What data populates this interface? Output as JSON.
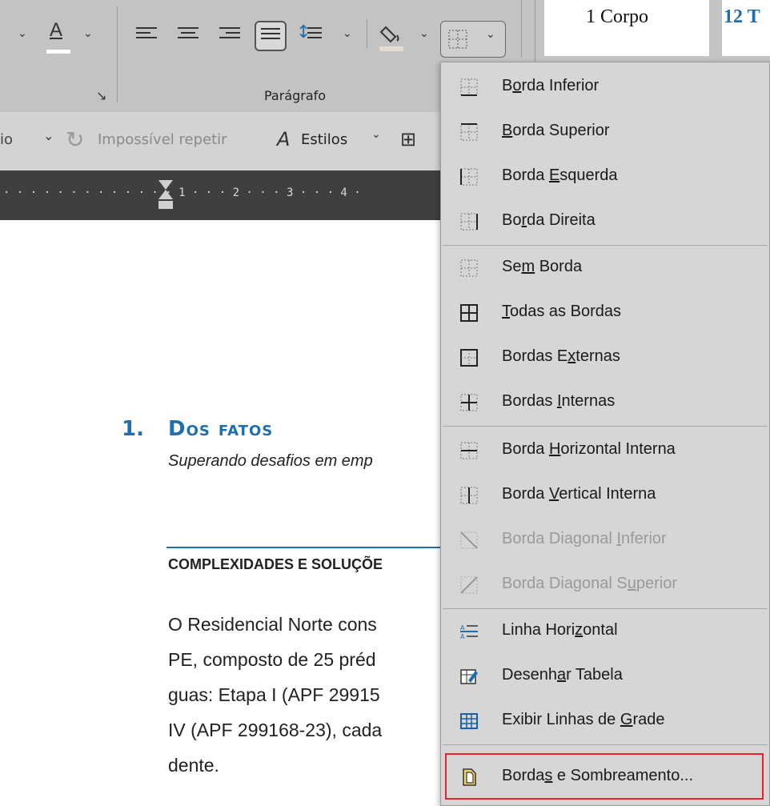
{
  "ribbon": {
    "font_color_label": "A",
    "style_normal": "1 Corpo",
    "style_title": "12 T",
    "dialog_launcher": "↘",
    "group_paragraph": "Parágrafo",
    "undo_partial": "io",
    "redo_label": "Impossível repetir",
    "styles_label": "Estilos"
  },
  "ruler": {
    "marks": "· · · · · · · · · · · · · 1 · · · 2 · · · 3 · · · 4 ·"
  },
  "document": {
    "heading_number": "1.",
    "heading_text": "Dos fatos",
    "subtitle": "Superando desafios em emp",
    "section_heading": "COMPLEXIDADES E SOLUÇÕE",
    "body_lines": [
      "O Residencial Norte cons",
      "PE, composto de 25 préd",
      "guas: Etapa I (APF 29915",
      "IV (APF 299168-23), cada",
      "dente."
    ]
  },
  "menu": {
    "items": [
      {
        "icon": "border-bottom-icon",
        "pre": "B",
        "u": "o",
        "post": "rda Inferior",
        "disabled": false
      },
      {
        "icon": "border-top-icon",
        "pre": "",
        "u": "B",
        "post": "orda Superior",
        "disabled": false
      },
      {
        "icon": "border-left-icon",
        "pre": "Borda ",
        "u": "E",
        "post": "squerda",
        "disabled": false
      },
      {
        "icon": "border-right-icon",
        "pre": "Bo",
        "u": "r",
        "post": "da Direita",
        "disabled": false
      },
      {
        "icon": "no-border-icon",
        "pre": "Se",
        "u": "m",
        "post": " Borda",
        "disabled": false
      },
      {
        "icon": "all-borders-icon",
        "pre": "",
        "u": "T",
        "post": "odas as Bordas",
        "disabled": false
      },
      {
        "icon": "outside-borders-icon",
        "pre": "Bordas E",
        "u": "x",
        "post": "ternas",
        "disabled": false
      },
      {
        "icon": "inside-borders-icon",
        "pre": "Bordas ",
        "u": "I",
        "post": "nternas",
        "disabled": false
      },
      {
        "icon": "inside-horizontal-border-icon",
        "pre": "Borda ",
        "u": "H",
        "post": "orizontal Interna",
        "disabled": false
      },
      {
        "icon": "inside-vertical-border-icon",
        "pre": "Borda ",
        "u": "V",
        "post": "ertical Interna",
        "disabled": false
      },
      {
        "icon": "diagonal-down-border-icon",
        "pre": "Borda Diagonal ",
        "u": "I",
        "post": "nferior",
        "disabled": true
      },
      {
        "icon": "diagonal-up-border-icon",
        "pre": "Borda Diagonal S",
        "u": "u",
        "post": "perior",
        "disabled": true
      },
      {
        "icon": "horizontal-line-icon",
        "pre": "Linha Hori",
        "u": "z",
        "post": "ontal",
        "disabled": false
      },
      {
        "icon": "draw-table-icon",
        "pre": "Desenh",
        "u": "a",
        "post": "r Tabela",
        "disabled": false
      },
      {
        "icon": "view-gridlines-icon",
        "pre": "Exibir Linhas de ",
        "u": "G",
        "post": "rade",
        "disabled": false
      },
      {
        "icon": "borders-shading-icon",
        "pre": "Borda",
        "u": "s",
        "post": " e Sombreamento...",
        "disabled": false
      }
    ]
  },
  "colors": {
    "heading_blue": "#1f6fb0",
    "highlight_red": "#e0262c",
    "menu_bg": "#d6d6d6"
  }
}
